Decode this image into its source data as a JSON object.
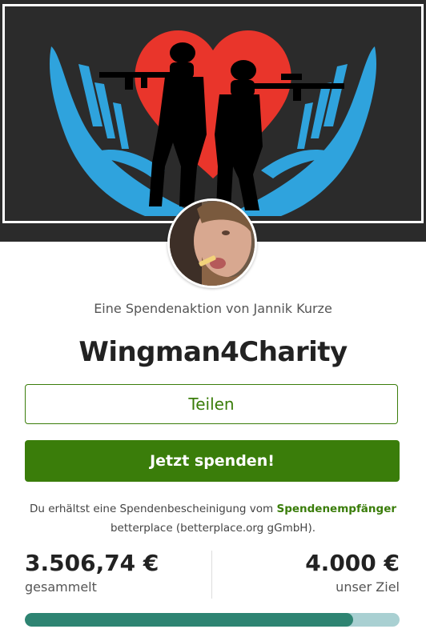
{
  "campaign": {
    "organizer_line": "Eine Spendenaktion von Jannik Kurze",
    "title": "Wingman4Charity"
  },
  "actions": {
    "share_label": "Teilen",
    "donate_label": "Jetzt spenden!"
  },
  "receipt": {
    "text_before": "Du erhältst eine Spendenbescheinigung vom",
    "link_text": "Spendenempfänger",
    "text_after": "betterplace (betterplace.org gGmbH)."
  },
  "stats": {
    "raised_amount": "3.506,74 €",
    "raised_label": "gesammelt",
    "goal_amount": "4.000 €",
    "goal_label": "unser Ziel",
    "progress_fraction": 0.877
  },
  "colors": {
    "brand_green": "#3a7d0a",
    "progress_fill": "#2e8472",
    "progress_track": "#a9d0d2"
  },
  "icons": {
    "hero": "hands-heart-soldiers-banner",
    "avatar": "organizer-avatar"
  }
}
